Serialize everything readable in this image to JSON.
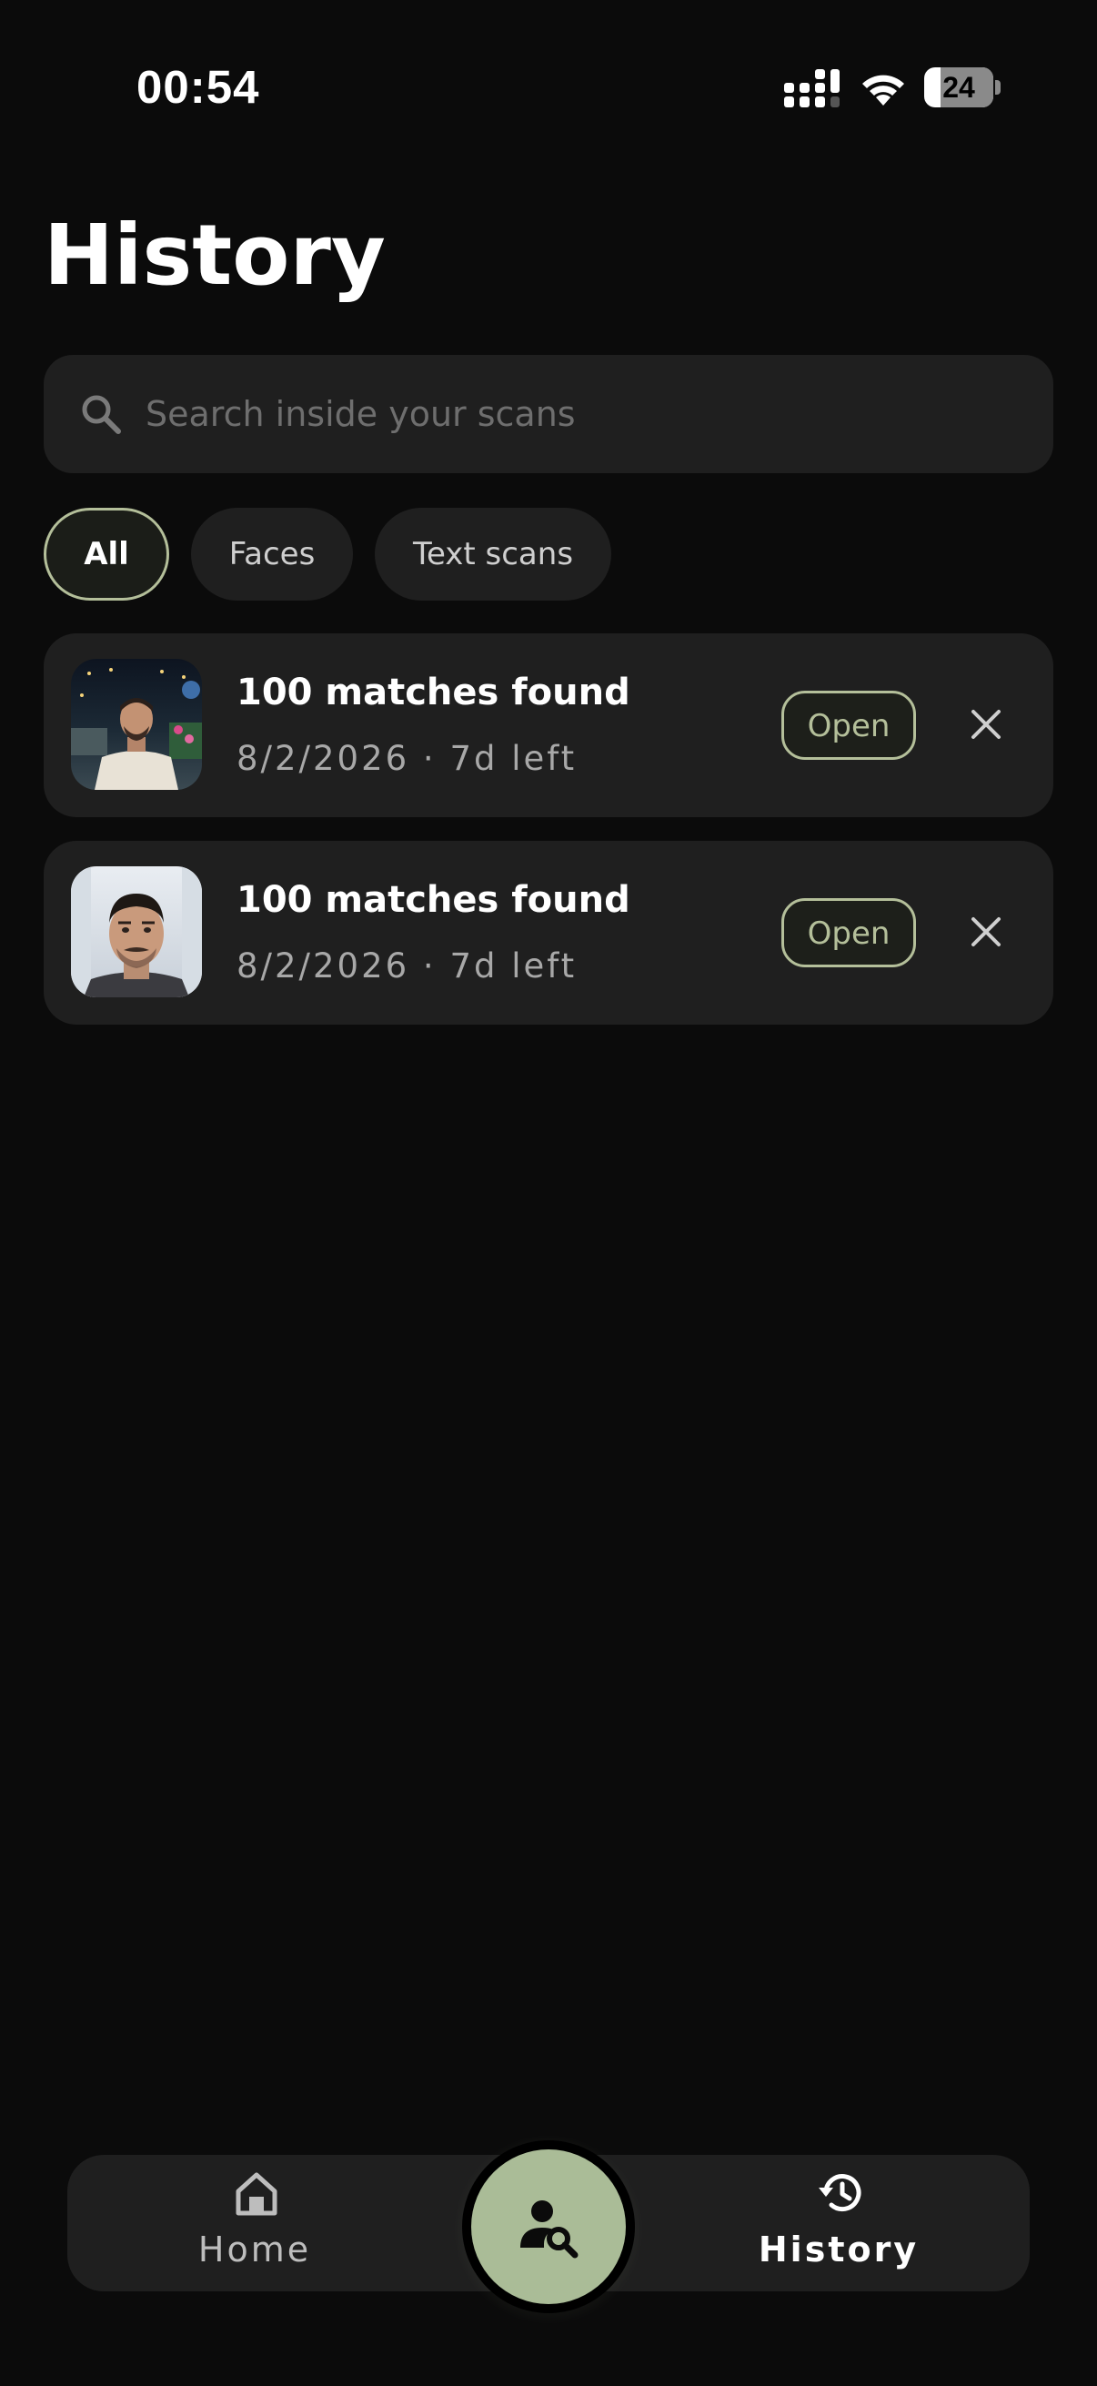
{
  "status_bar": {
    "time": "00:54",
    "battery_level": "24",
    "battery_fraction": 0.24
  },
  "header": {
    "title": "History"
  },
  "search": {
    "placeholder": "Search inside your scans",
    "value": ""
  },
  "filters": [
    {
      "label": "All",
      "selected": true
    },
    {
      "label": "Faces",
      "selected": false
    },
    {
      "label": "Text scans",
      "selected": false
    }
  ],
  "scans": [
    {
      "title": "100 matches found",
      "meta": "8/2/2026 · 7d left",
      "open_label": "Open",
      "thumbnail": "man-at-night-party-photo"
    },
    {
      "title": "100 matches found",
      "meta": "8/2/2026 · 7d left",
      "open_label": "Open",
      "thumbnail": "man-face-selfie-photo"
    }
  ],
  "bottom_nav": {
    "home_label": "Home",
    "history_label": "History",
    "center_action_icon": "face-search-icon"
  },
  "colors": {
    "background": "#0b0b0b",
    "surface": "#1f1f1f",
    "accent": "#b4bf9a",
    "fab": "#aabc97"
  }
}
